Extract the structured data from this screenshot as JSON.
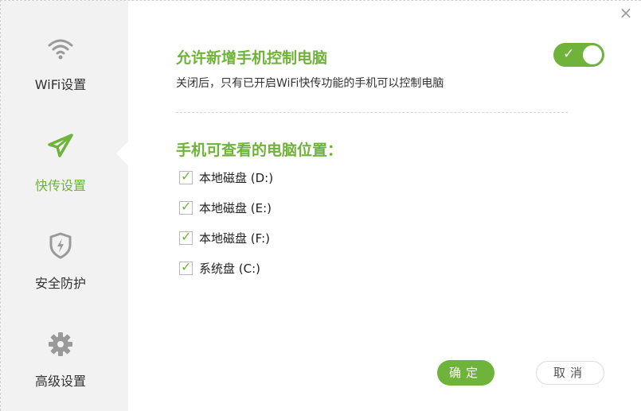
{
  "window": {
    "close_glyph": "×"
  },
  "sidebar": {
    "items": [
      {
        "label": "WiFi设置",
        "icon": "wifi-icon",
        "active": false
      },
      {
        "label": "快传设置",
        "icon": "paper-plane-icon",
        "active": true
      },
      {
        "label": "安全防护",
        "icon": "shield-lightning-icon",
        "active": false
      },
      {
        "label": "高级设置",
        "icon": "gear-icon",
        "active": false
      }
    ]
  },
  "main": {
    "allow_title": "允许新增手机控制电脑",
    "allow_desc": "关闭后，只有已开启WiFi快传功能的手机可以控制电脑",
    "allow_toggle_on": true,
    "locations_title": "手机可查看的电脑位置：",
    "drives": [
      {
        "label": "本地磁盘 (D:)",
        "checked": true
      },
      {
        "label": "本地磁盘 (E:)",
        "checked": true
      },
      {
        "label": "本地磁盘 (F:)",
        "checked": true
      },
      {
        "label": "系统盘 (C:)",
        "checked": true
      }
    ],
    "ok_label": "确定",
    "cancel_label": "取消"
  },
  "colors": {
    "accent": "#6fb33a",
    "sidebar_bg": "#f2f2f2",
    "text": "#333333"
  }
}
